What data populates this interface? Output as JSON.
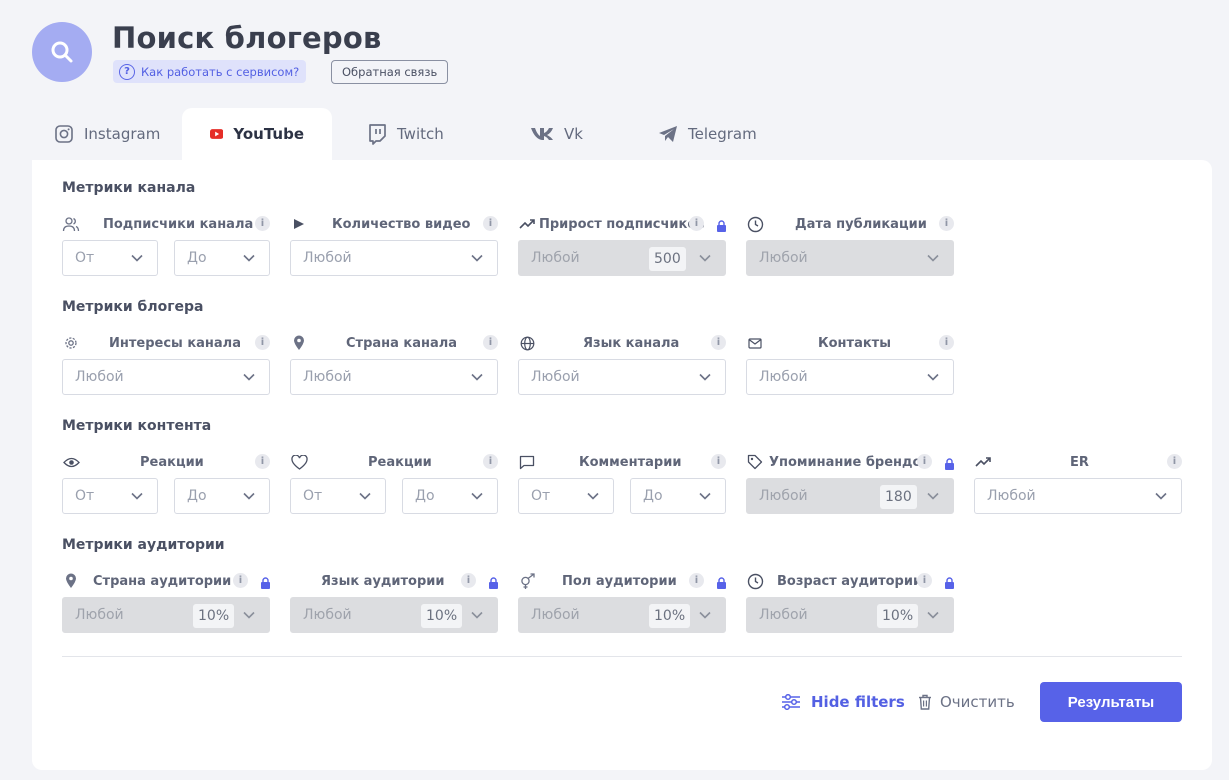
{
  "header": {
    "title": "Поиск блогеров",
    "help_link": "Как работать с сервисом?",
    "feedback": "Обратная связь"
  },
  "tabs": [
    {
      "label": "Instagram",
      "icon": "instagram-icon"
    },
    {
      "label": "YouTube",
      "icon": "youtube-icon",
      "active": true
    },
    {
      "label": "Twitch",
      "icon": "twitch-icon"
    },
    {
      "label": "Vk",
      "icon": "vk-icon"
    },
    {
      "label": "Telegram",
      "icon": "telegram-icon"
    }
  ],
  "sections": {
    "channel": "Метрики канала",
    "blogger": "Метрики блогера",
    "content": "Метрики контента",
    "audience": "Метрики аудитории"
  },
  "labels": {
    "subscribers": "Подписчики канала",
    "video_count": "Количество видео",
    "subscriber_growth": "Прирост подписчиков",
    "publish_date": "Дата публикации",
    "interests": "Интересы канала",
    "channel_country": "Страна канала",
    "channel_language": "Язык канала",
    "contacts": "Контакты",
    "views": "Реакции",
    "reactions": "Реакции",
    "comments": "Комментарии",
    "brand_mentions": "Упоминание брендов",
    "er": "ER",
    "audience_country": "Страна аудитории",
    "audience_language": "Язык аудитории",
    "audience_gender": "Пол аудитории",
    "audience_age": "Возраст аудитории"
  },
  "values": {
    "from": "От",
    "to": "До",
    "any": "Любой",
    "growth_pill": "500",
    "brands_pill": "180",
    "percent_pill": "10%"
  },
  "info_glyph": "i",
  "actions": {
    "hide_filters": "Hide filters",
    "clear": "Очистить",
    "results": "Результаты"
  },
  "colors": {
    "accent": "#5762e8",
    "avatar": "#a4acf2",
    "youtube_red": "#e52d27",
    "disabled_field": "#dcdde0"
  }
}
